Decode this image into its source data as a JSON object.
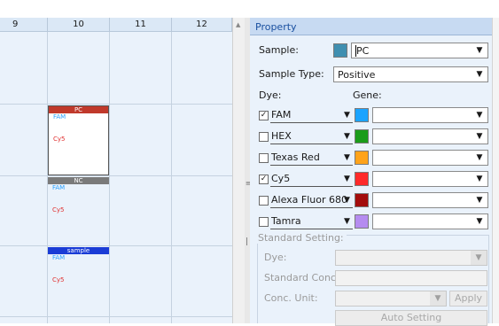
{
  "plate": {
    "columns": [
      "9",
      "10",
      "11",
      "12"
    ],
    "wells": [
      {
        "title": "PC",
        "title_color": "#c0392b",
        "fam": "FAM",
        "cy5": "Cy5"
      },
      {
        "title": "NC",
        "title_color": "#7a7a7a",
        "fam": "FAM",
        "cy5": "Cy5"
      },
      {
        "title": "sample",
        "title_color": "#1a3cd6",
        "fam": "FAM",
        "cy5": "Cy5"
      }
    ]
  },
  "panel": {
    "header": "Property",
    "sample_label": "Sample:",
    "sample_color": "#3f8fb0",
    "sample_value": "PC",
    "sample_type_label": "Sample Type:",
    "sample_type_value": "Positive",
    "dye_label": "Dye:",
    "gene_label": "Gene:",
    "dyes": [
      {
        "name": "FAM",
        "checked": true,
        "color": "#1aa3ff",
        "gene": ""
      },
      {
        "name": "HEX",
        "checked": false,
        "color": "#1a9c1a",
        "gene": ""
      },
      {
        "name": "Texas Red",
        "checked": false,
        "color": "#ffa31a",
        "gene": ""
      },
      {
        "name": "Cy5",
        "checked": true,
        "color": "#ff2a2a",
        "gene": ""
      },
      {
        "name": "Alexa Fluor 680",
        "checked": false,
        "color": "#a30d0d",
        "gene": ""
      },
      {
        "name": "Tamra",
        "checked": false,
        "color": "#b58cf0",
        "gene": ""
      }
    ],
    "standard": {
      "title": "Standard Setting:",
      "dye_label": "Dye:",
      "conc_label": "Standard Conc.:",
      "unit_label": "Conc. Unit:",
      "apply_label": "Apply",
      "auto_label": "Auto Setting"
    }
  }
}
